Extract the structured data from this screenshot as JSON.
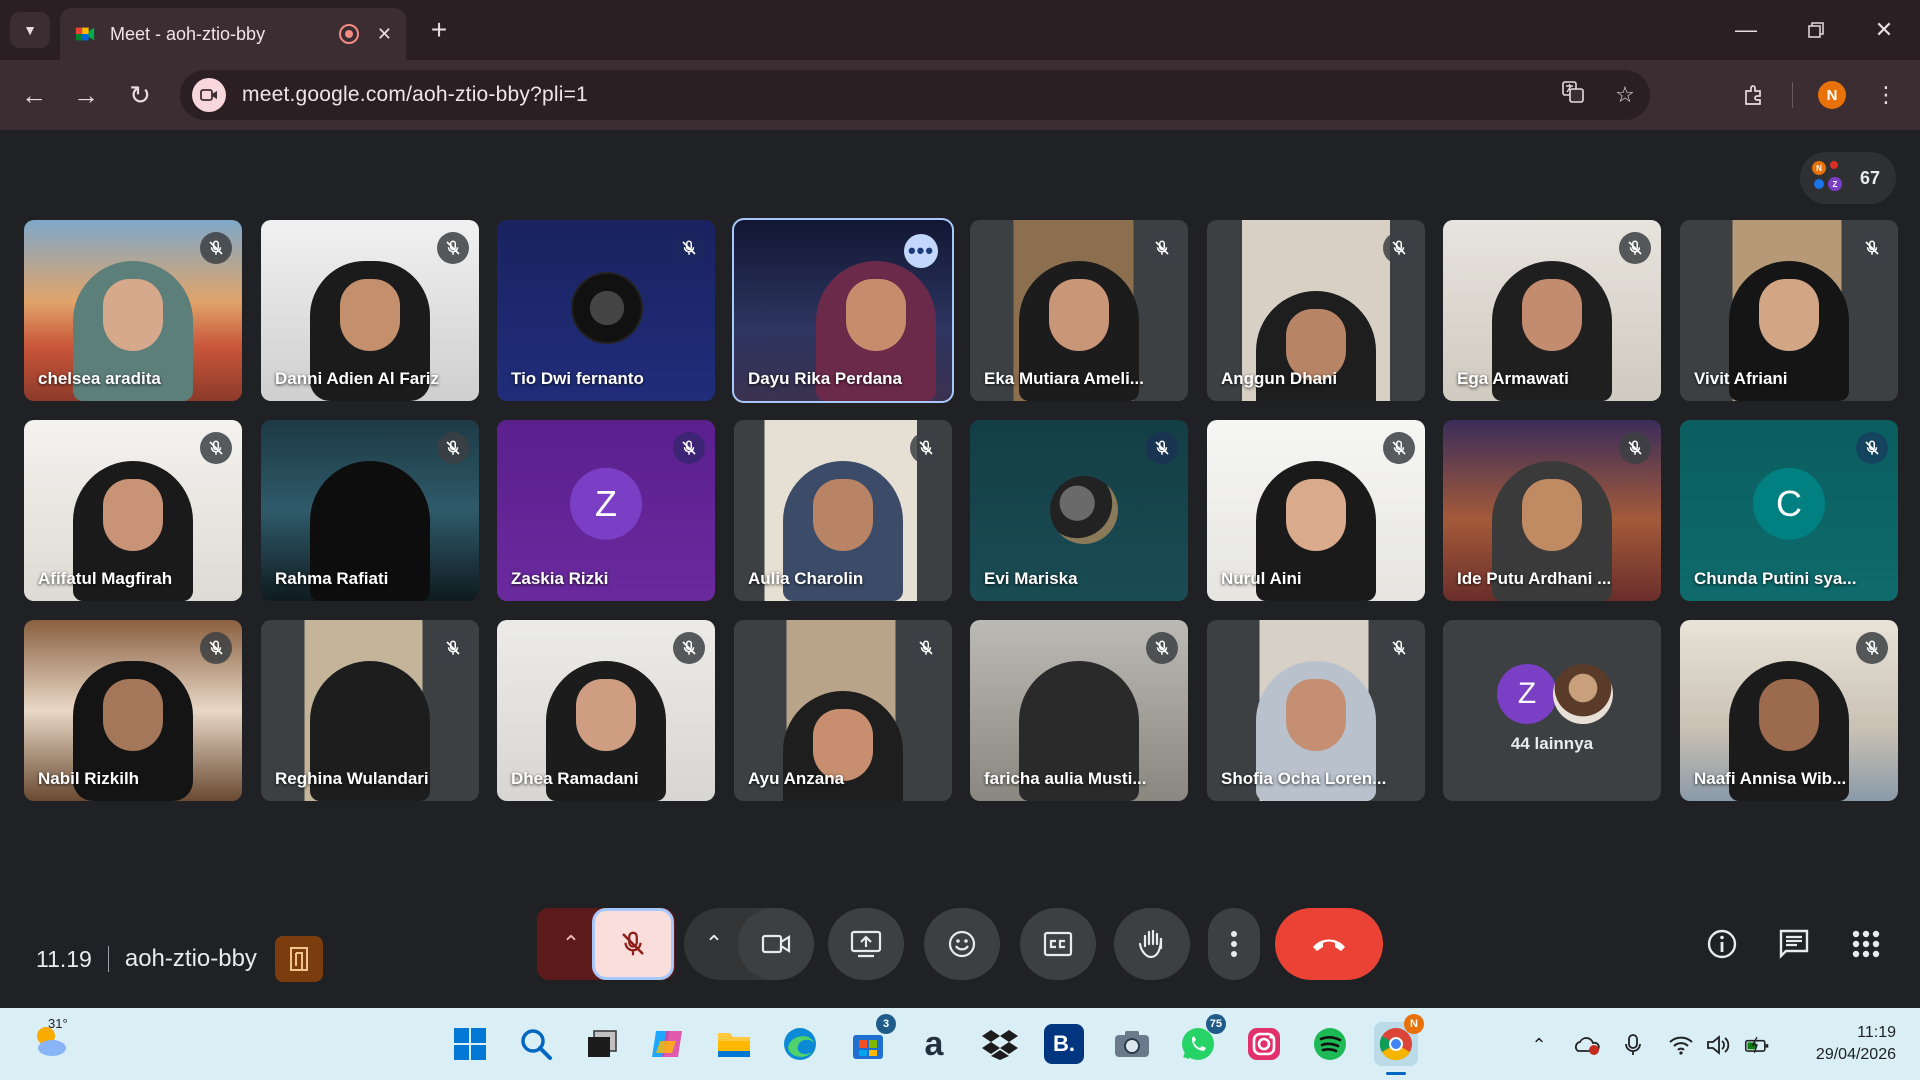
{
  "browser": {
    "tab_title": "Meet - aoh-ztio-bby",
    "new_tab_glyph": "+",
    "url": "meet.google.com/aoh-ztio-bby?pli=1",
    "profile_initial": "N"
  },
  "meet": {
    "participant_count": "67",
    "count_avatar_initials": [
      "N",
      "Z"
    ],
    "participants": [
      {
        "name": "chelsea aradita"
      },
      {
        "name": "Danni Adien Al Fariz"
      },
      {
        "name": "Tio Dwi fernanto"
      },
      {
        "name": "Dayu Rika Perdana"
      },
      {
        "name": "Eka Mutiara Ameli..."
      },
      {
        "name": "Anggun Dhani"
      },
      {
        "name": "Ega Armawati"
      },
      {
        "name": "Vivit Afriani"
      },
      {
        "name": "Afifatul Magfirah"
      },
      {
        "name": "Rahma Rafiati"
      },
      {
        "name": "Zaskia Rizki",
        "initial": "Z"
      },
      {
        "name": "Aulia Charolin"
      },
      {
        "name": "Evi Mariska"
      },
      {
        "name": "Nurul Aini"
      },
      {
        "name": "Ide Putu Ardhani ..."
      },
      {
        "name": "Chunda Putini sya...",
        "initial": "C"
      },
      {
        "name": "Nabil Rizkilh"
      },
      {
        "name": "Reghina Wulandari"
      },
      {
        "name": "Dhea Ramadani"
      },
      {
        "name": "Ayu Anzana"
      },
      {
        "name": "faricha aulia Musti..."
      },
      {
        "name": "Shofia Ocha Loren..."
      },
      {
        "name": "Naafi Annisa Wib..."
      }
    ],
    "others_label": "44 lainnya",
    "others_initial": "Z",
    "more_glyph": "•••",
    "time": "11.19",
    "meeting_code": "aoh-ztio-bby"
  },
  "taskbar": {
    "weather_temp": "31°",
    "store_badge": "3",
    "whatsapp_badge": "75",
    "chrome_badge": "N",
    "booking_letter": "B.",
    "amazon_letter": "a",
    "clock_time": "11:19",
    "clock_date": "29/04/2026"
  },
  "colors": {
    "accent_blue": "#a8c7fa",
    "end_call_red": "#ea4335",
    "mic_off_pink": "#f9dedc"
  }
}
